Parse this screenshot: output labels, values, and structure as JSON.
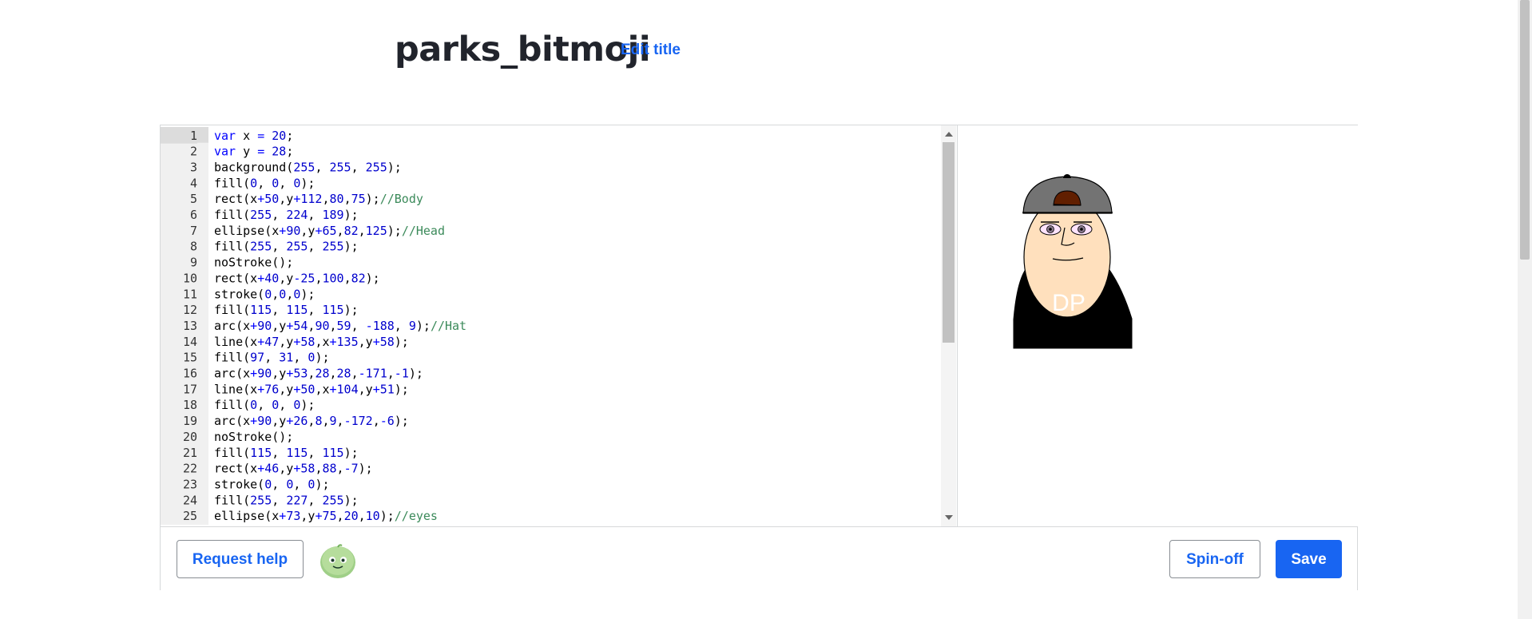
{
  "header": {
    "title": "parks_bitmoji",
    "edit_title_label": "Edit title"
  },
  "editor": {
    "active_line": 1,
    "lines": [
      {
        "n": "1",
        "code": "var x = 20;"
      },
      {
        "n": "2",
        "code": "var y = 28;"
      },
      {
        "n": "3",
        "code": "background(255, 255, 255);"
      },
      {
        "n": "4",
        "code": "fill(0, 0, 0);"
      },
      {
        "n": "5",
        "code": "rect(x+50,y+112,80,75);//Body"
      },
      {
        "n": "6",
        "code": "fill(255, 224, 189);"
      },
      {
        "n": "7",
        "code": "ellipse(x+90,y+65,82,125);//Head"
      },
      {
        "n": "8",
        "code": "fill(255, 255, 255);"
      },
      {
        "n": "9",
        "code": "noStroke();"
      },
      {
        "n": "10",
        "code": "rect(x+40,y-25,100,82);"
      },
      {
        "n": "11",
        "code": "stroke(0,0,0);"
      },
      {
        "n": "12",
        "code": "fill(115, 115, 115);"
      },
      {
        "n": "13",
        "code": "arc(x+90,y+54,90,59, -188, 9);//Hat"
      },
      {
        "n": "14",
        "code": "line(x+47,y+58,x+135,y+58);"
      },
      {
        "n": "15",
        "code": "fill(97, 31, 0);"
      },
      {
        "n": "16",
        "code": "arc(x+90,y+53,28,28,-171,-1);"
      },
      {
        "n": "17",
        "code": "line(x+76,y+50,x+104,y+51);"
      },
      {
        "n": "18",
        "code": "fill(0, 0, 0);"
      },
      {
        "n": "19",
        "code": "arc(x+90,y+26,8,9,-172,-6);"
      },
      {
        "n": "20",
        "code": "noStroke();"
      },
      {
        "n": "21",
        "code": "fill(115, 115, 115);"
      },
      {
        "n": "22",
        "code": "rect(x+46,y+58,88,-7);"
      },
      {
        "n": "23",
        "code": "stroke(0, 0, 0);"
      },
      {
        "n": "24",
        "code": "fill(255, 227, 255);"
      },
      {
        "n": "25",
        "code": "ellipse(x+73,y+75,20,10);//eyes"
      }
    ]
  },
  "canvas": {
    "shirt_text": "DP",
    "colors": {
      "hat": "#737373",
      "hat_button": "#611f00",
      "skin": "#ffe0bd",
      "eyes": "#ffe3ff",
      "body": "#000000"
    }
  },
  "toolbar": {
    "request_help_label": "Request help",
    "avatar_icon": "green-blob-avatar-icon",
    "spinoff_label": "Spin-off",
    "save_label": "Save"
  },
  "colors": {
    "accent": "#1865f2",
    "comment": "#3b8a5a",
    "keyword": "#0000ff"
  }
}
